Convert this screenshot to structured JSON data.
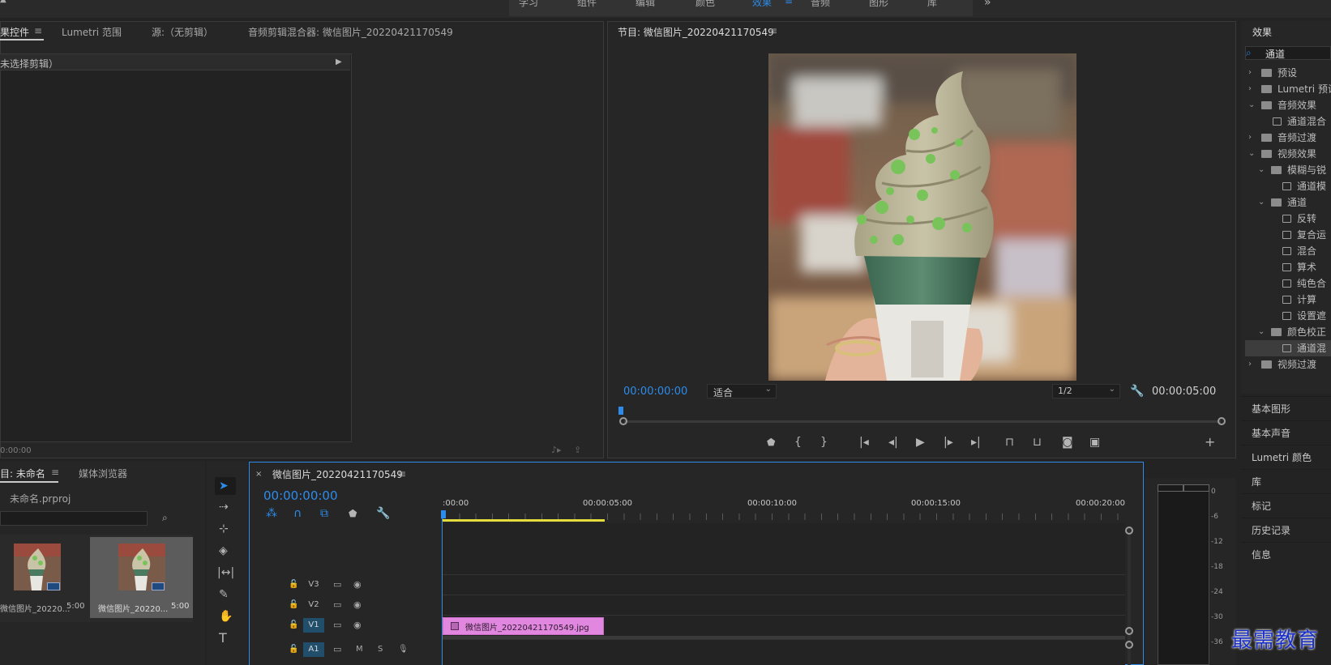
{
  "workspaces": [
    "学习",
    "组件",
    "编辑",
    "颜色",
    "效果",
    "音频",
    "图形",
    "库"
  ],
  "workspace_active_index": 4,
  "effect_controls": {
    "tabs": [
      "果控件",
      "Lumetri 范围",
      "源:（无剪辑）",
      "音频剪辑混合器: 微信图片_20220421170549"
    ],
    "no_clip": "未选择剪辑）",
    "timecode": "0:00:00"
  },
  "program_monitor": {
    "title": "节目: 微信图片_20220421170549",
    "timecode": "00:00:00:00",
    "fit": "适合",
    "resolution": "1/2",
    "duration": "00:00:05:00"
  },
  "effects_panel": {
    "title": "效果",
    "search_value": "通道",
    "tree": [
      {
        "label": "预设",
        "depth": 0,
        "kind": "folder",
        "twisty": "›"
      },
      {
        "label": "Lumetri 预设",
        "depth": 0,
        "kind": "folder",
        "twisty": "›"
      },
      {
        "label": "音频效果",
        "depth": 0,
        "kind": "folder",
        "twisty": "⌄"
      },
      {
        "label": "通道混合",
        "depth": 1,
        "kind": "fx",
        "twisty": ""
      },
      {
        "label": "音频过渡",
        "depth": 0,
        "kind": "folder",
        "twisty": "›"
      },
      {
        "label": "视频效果",
        "depth": 0,
        "kind": "folder",
        "twisty": "⌄"
      },
      {
        "label": "模糊与锐",
        "depth": 1,
        "kind": "folder",
        "twisty": "⌄"
      },
      {
        "label": "通道模",
        "depth": 2,
        "kind": "fx",
        "twisty": ""
      },
      {
        "label": "通道",
        "depth": 1,
        "kind": "folder",
        "twisty": "⌄"
      },
      {
        "label": "反转",
        "depth": 2,
        "kind": "fx",
        "twisty": ""
      },
      {
        "label": "复合运",
        "depth": 2,
        "kind": "fx",
        "twisty": ""
      },
      {
        "label": "混合",
        "depth": 2,
        "kind": "fx",
        "twisty": ""
      },
      {
        "label": "算术",
        "depth": 2,
        "kind": "fx",
        "twisty": ""
      },
      {
        "label": "纯色合",
        "depth": 2,
        "kind": "fx",
        "twisty": ""
      },
      {
        "label": "计算",
        "depth": 2,
        "kind": "fx",
        "twisty": ""
      },
      {
        "label": "设置遮",
        "depth": 2,
        "kind": "fx",
        "twisty": ""
      },
      {
        "label": "颜色校正",
        "depth": 1,
        "kind": "folder",
        "twisty": "⌄"
      },
      {
        "label": "通道混",
        "depth": 2,
        "kind": "fx",
        "twisty": "",
        "selected": true
      },
      {
        "label": "视频过渡",
        "depth": 0,
        "kind": "folder",
        "twisty": "›"
      }
    ]
  },
  "side_panels": [
    "基本图形",
    "基本声音",
    "Lumetri 颜色",
    "库",
    "标记",
    "历史记录",
    "信息"
  ],
  "project": {
    "tabs": [
      "目: 未命名",
      "媒体浏览器"
    ],
    "file": "未命名.prproj",
    "items": [
      {
        "name": "微信图片_20220...",
        "duration": "5:00"
      },
      {
        "name": "微信图片_20220...",
        "duration": "5:00"
      }
    ]
  },
  "timeline": {
    "title": "微信图片_20220421170549",
    "timecode": "00:00:00:00",
    "ruler": [
      ":00:00",
      "00:00:05:00",
      "00:00:10:00",
      "00:00:15:00",
      "00:00:20:00"
    ],
    "tracks": [
      {
        "name": "V3",
        "active": false,
        "type": "video"
      },
      {
        "name": "V2",
        "active": false,
        "type": "video"
      },
      {
        "name": "V1",
        "active": true,
        "type": "video"
      },
      {
        "name": "A1",
        "active": true,
        "type": "audio"
      }
    ],
    "clip": "微信图片_20220421170549.jpg",
    "audio_ms": [
      "M",
      "S"
    ]
  },
  "meter_scale": [
    "0",
    "-6",
    "-12",
    "-18",
    "-24",
    "-30",
    "-36"
  ],
  "watermark": "最需教育",
  "colors": {
    "accent": "#2d8ceb",
    "clip": "#e287e0",
    "work_area": "#e3dc3c",
    "selection": "#3d3d3d"
  }
}
